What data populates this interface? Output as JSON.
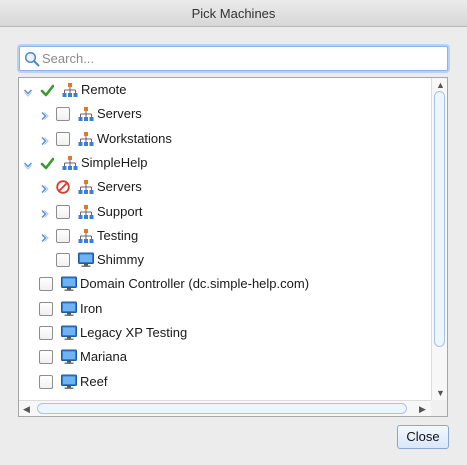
{
  "window": {
    "title": "Pick Machines"
  },
  "search": {
    "placeholder": "Search...",
    "value": ""
  },
  "tree": {
    "rows": [
      {
        "label": "Remote",
        "state": "checked",
        "type": "group",
        "expanded": true
      },
      {
        "label": "Servers",
        "state": "unchecked",
        "type": "group",
        "expanded": false
      },
      {
        "label": "Workstations",
        "state": "unchecked",
        "type": "group",
        "expanded": false
      },
      {
        "label": "SimpleHelp",
        "state": "checked",
        "type": "group",
        "expanded": true
      },
      {
        "label": "Servers",
        "state": "blocked",
        "type": "group",
        "expanded": false
      },
      {
        "label": "Support",
        "state": "unchecked",
        "type": "group",
        "expanded": false
      },
      {
        "label": "Testing",
        "state": "unchecked",
        "type": "group",
        "expanded": false
      },
      {
        "label": "Shimmy",
        "state": "unchecked",
        "type": "machine"
      },
      {
        "label": "Domain Controller (dc.simple-help.com)",
        "state": "unchecked",
        "type": "machine"
      },
      {
        "label": "Iron",
        "state": "unchecked",
        "type": "machine"
      },
      {
        "label": "Legacy XP Testing",
        "state": "unchecked",
        "type": "machine"
      },
      {
        "label": "Mariana",
        "state": "unchecked",
        "type": "machine"
      },
      {
        "label": "Reef",
        "state": "unchecked",
        "type": "machine"
      }
    ]
  },
  "buttons": {
    "close": "Close"
  },
  "icons": {
    "expanded": "chevron-down-icon",
    "collapsed": "chevron-right-icon",
    "checked": "checkmark-icon",
    "blocked": "no-entry-icon",
    "group": "group-hierarchy-icon",
    "machine": "monitor-icon",
    "search": "search-icon"
  },
  "colors": {
    "check_green": "#3a9a2c",
    "blocked_red": "#d93a2f",
    "group_orange": "#e0782a",
    "group_blue": "#3b7fd4",
    "monitor_blue": "#2f7fd0",
    "expander_blue": "#5b8fd6"
  }
}
